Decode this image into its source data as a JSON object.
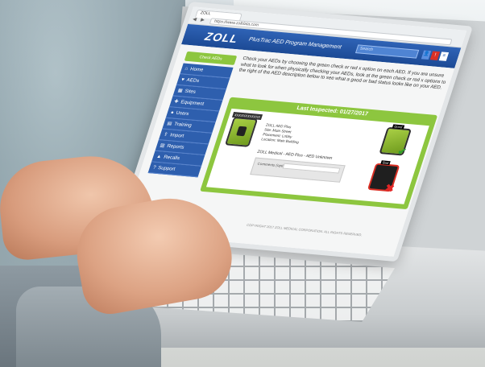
{
  "browser": {
    "tab_title": "ZOLL",
    "url": "https://www.zolldata.com"
  },
  "app": {
    "logo": "ZOLL",
    "title": "PlusTrac AED Program Management",
    "search_placeholder": "Search",
    "accent_blue": "#2e5fae",
    "accent_green": "#8dc63f"
  },
  "sidebar": {
    "check_button": "Check AEDs",
    "items": [
      {
        "label": "Home",
        "icon": "home-icon"
      },
      {
        "label": "AEDs",
        "icon": "heart-icon"
      },
      {
        "label": "Sites",
        "icon": "building-icon"
      },
      {
        "label": "Equipment",
        "icon": "gear-icon"
      },
      {
        "label": "Users",
        "icon": "users-icon"
      },
      {
        "label": "Training",
        "icon": "book-icon"
      },
      {
        "label": "Import",
        "icon": "upload-icon"
      },
      {
        "label": "Reports",
        "icon": "chart-icon"
      },
      {
        "label": "Recalls",
        "icon": "warning-icon"
      },
      {
        "label": "Support",
        "icon": "help-icon"
      }
    ]
  },
  "main": {
    "intro_text": "Check your AEDs by choosing the green check or red x option on each AED. If you are unsure what to look for when physically checking your AEDs, look at the green check or red x options to the right of the AED description below to see what a good or bad status looks like on your AED.",
    "panel_title": "Last Inspected: 01/27/2017",
    "aed": {
      "serial": "XXXXXXXXXXXX",
      "line1": "ZOLL AED Plus",
      "line2": "Site: Main Street",
      "line3": "Placement: Lobby",
      "line4": "Location: Main Building",
      "status_line": "ZOLL Medical - AED Plus - AED Unknown",
      "comments_label": "Comments (optional)"
    },
    "good_label": "Good",
    "bad_label": "Bad",
    "footer": "COPYRIGHT 2017 ZOLL MEDICAL CORPORATION. ALL RIGHTS RESERVED."
  }
}
